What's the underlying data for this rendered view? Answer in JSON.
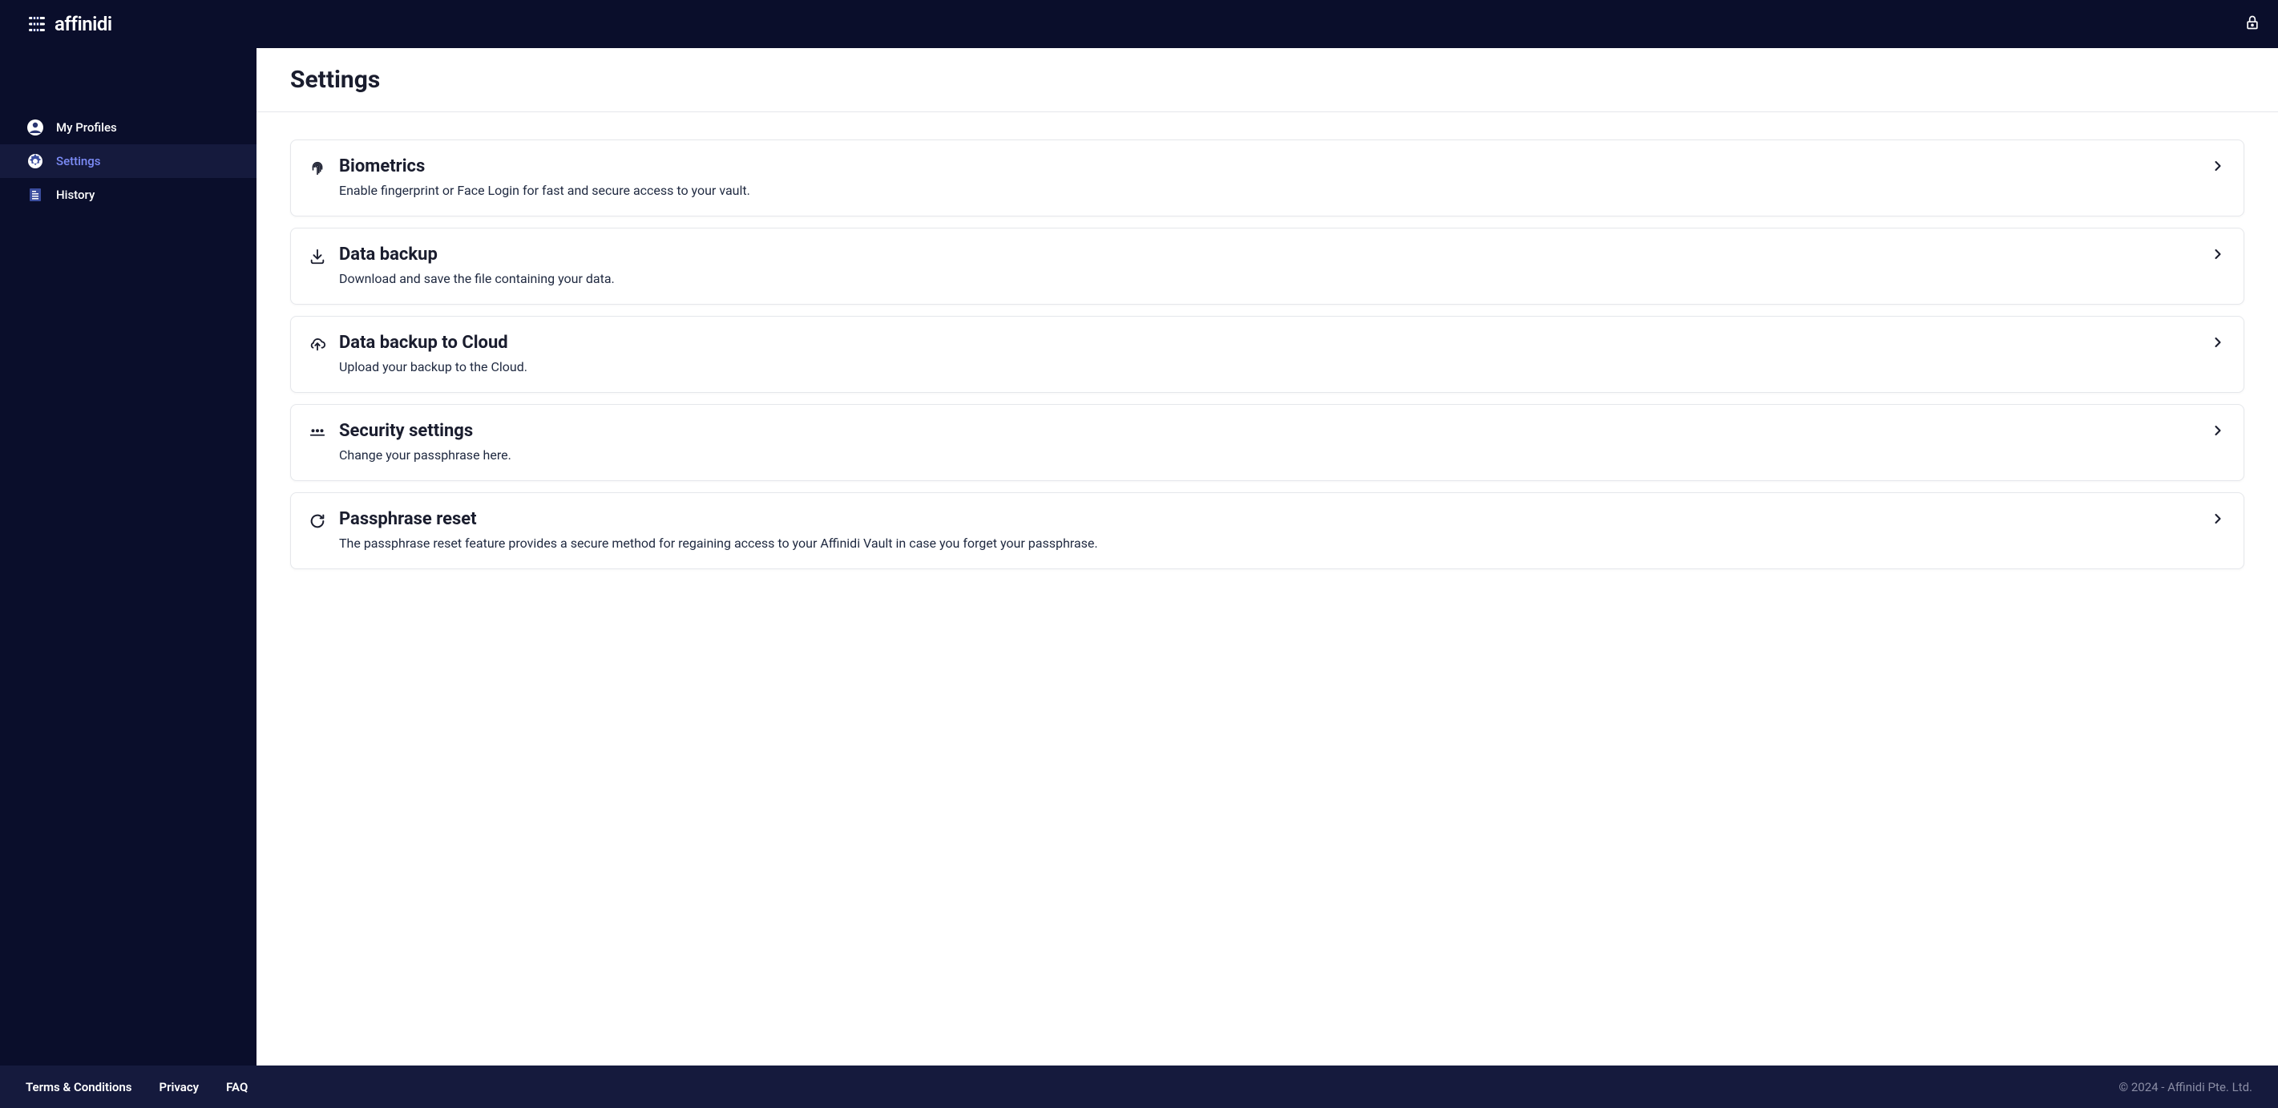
{
  "header": {
    "brand": "affinidi"
  },
  "sidebar": {
    "items": [
      {
        "label": "My Profiles"
      },
      {
        "label": "Settings"
      },
      {
        "label": "History"
      }
    ]
  },
  "page": {
    "title": "Settings"
  },
  "settings": [
    {
      "title": "Biometrics",
      "desc": "Enable fingerprint or Face Login for fast and secure access to your vault."
    },
    {
      "title": "Data backup",
      "desc": "Download and save the file containing your data."
    },
    {
      "title": "Data backup to Cloud",
      "desc": "Upload your backup to the Cloud."
    },
    {
      "title": "Security settings",
      "desc": "Change your passphrase here."
    },
    {
      "title": "Passphrase reset",
      "desc": "The passphrase reset feature provides a secure method for regaining access to your Affinidi Vault in case you forget your passphrase."
    }
  ],
  "footer": {
    "links": [
      {
        "label": "Terms & Conditions"
      },
      {
        "label": "Privacy"
      },
      {
        "label": "FAQ"
      }
    ],
    "copyright": "© 2024 - Affinidi Pte. Ltd."
  }
}
